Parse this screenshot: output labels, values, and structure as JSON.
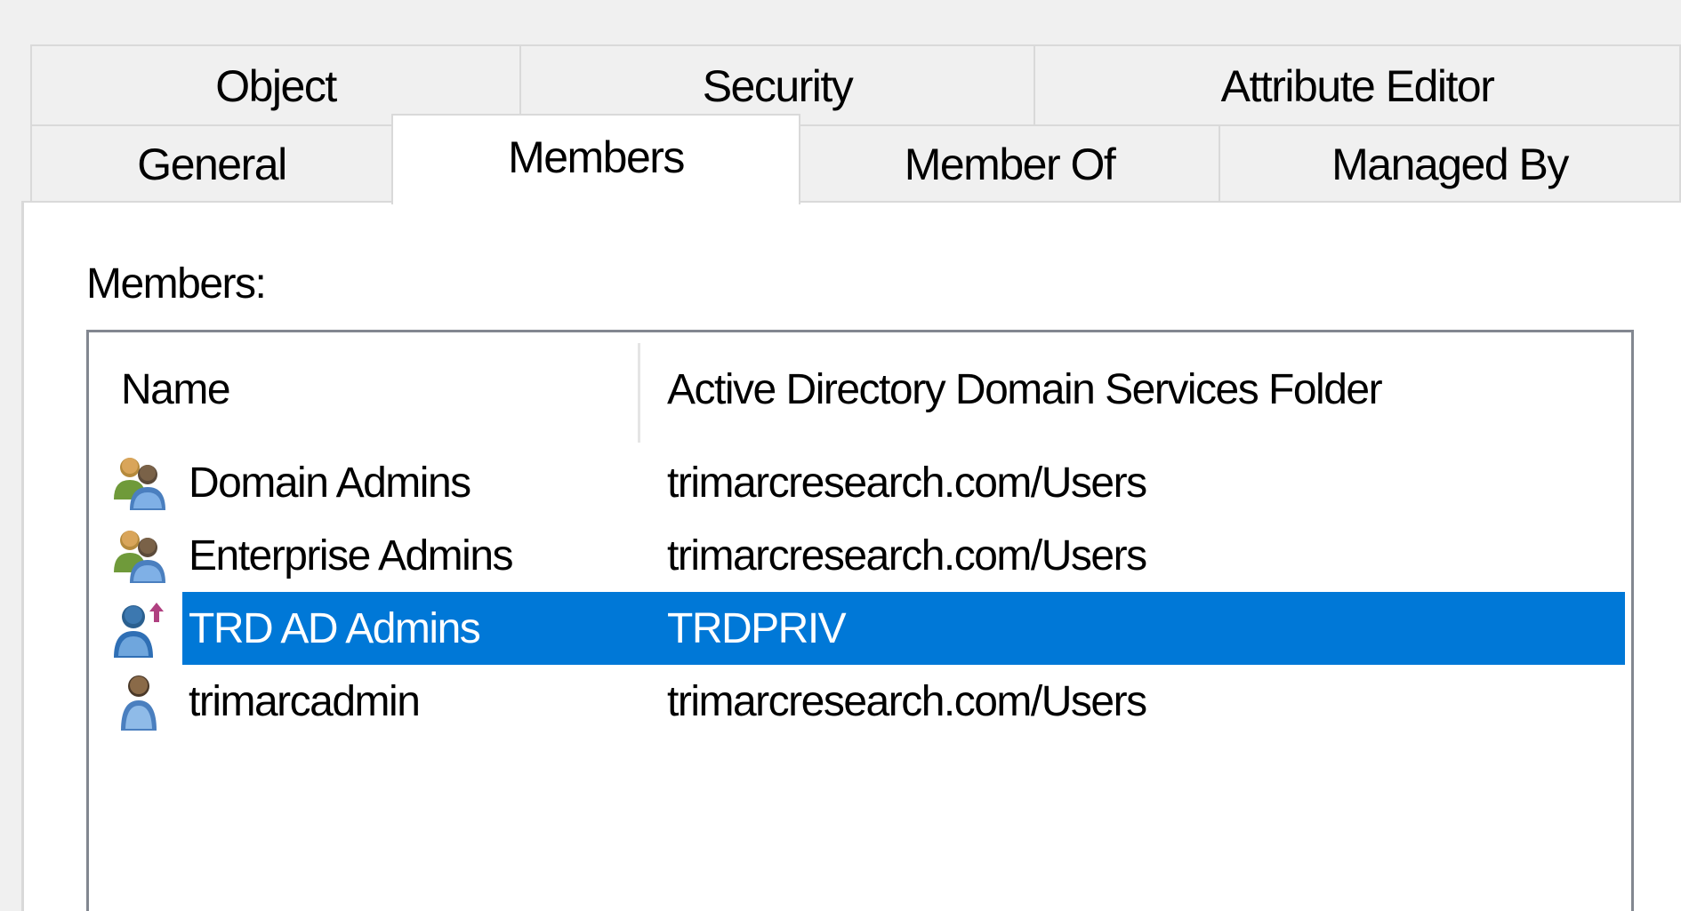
{
  "tabs_top": [
    {
      "label": "Object"
    },
    {
      "label": "Security"
    },
    {
      "label": "Attribute Editor"
    }
  ],
  "tabs_bottom": [
    {
      "label": "General"
    },
    {
      "label": "Members",
      "active": true
    },
    {
      "label": "Member Of"
    },
    {
      "label": "Managed By"
    }
  ],
  "members_panel": {
    "label": "Members:",
    "columns": {
      "name": "Name",
      "folder": "Active Directory Domain Services Folder"
    },
    "rows": [
      {
        "name": "Domain Admins",
        "folder": "trimarcresearch.com/Users",
        "icon": "group-icon",
        "selected": false
      },
      {
        "name": "Enterprise Admins",
        "folder": "trimarcresearch.com/Users",
        "icon": "group-icon",
        "selected": false
      },
      {
        "name": "TRD AD Admins",
        "folder": "TRDPRIV",
        "icon": "foreign-security-principal-icon",
        "selected": true
      },
      {
        "name": "trimarcadmin",
        "folder": "trimarcresearch.com/Users",
        "icon": "user-icon",
        "selected": false
      }
    ]
  },
  "colors": {
    "selection": "#0078d7",
    "window_bg": "#f0f0f0",
    "list_border": "#828790"
  }
}
